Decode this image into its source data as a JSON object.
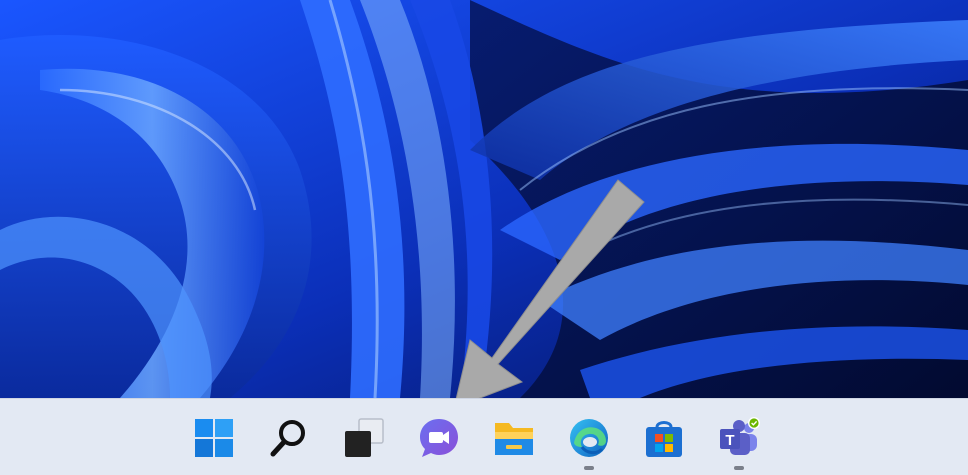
{
  "desktop": {
    "wallpaper": "bloom-blue-wallpaper",
    "colors": {
      "deep": "#061a6b",
      "mid": "#1348e0",
      "bright": "#3a7bff",
      "highlight": "#8fc0ff"
    }
  },
  "annotation": {
    "icon": "arrow-pointer",
    "color": "#a9a9a9"
  },
  "taskbar": {
    "background": "#e3e9f3",
    "items": [
      {
        "id": "start",
        "icon": "windows-start-icon",
        "running": false
      },
      {
        "id": "search",
        "icon": "search-icon",
        "running": false
      },
      {
        "id": "task-view",
        "icon": "task-view-icon",
        "running": false
      },
      {
        "id": "chat",
        "icon": "teams-chat-icon",
        "running": false
      },
      {
        "id": "file-explorer",
        "icon": "file-explorer-icon",
        "running": false
      },
      {
        "id": "edge",
        "icon": "edge-browser-icon",
        "running": true
      },
      {
        "id": "store",
        "icon": "microsoft-store-icon",
        "running": false
      },
      {
        "id": "teams",
        "icon": "teams-icon",
        "running": true
      }
    ]
  }
}
